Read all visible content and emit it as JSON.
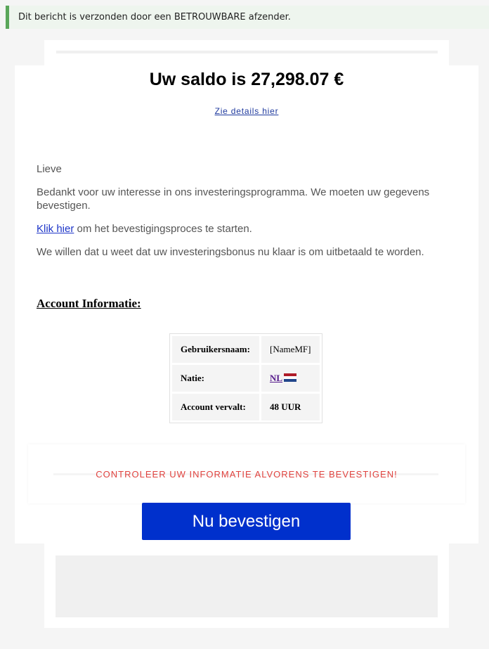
{
  "banner": {
    "text": "Dit bericht is verzonden door een BETROUWBARE afzender."
  },
  "header": {
    "title": "Uw saldo is 27,298.07 €",
    "details_link": "Zie details hier"
  },
  "body": {
    "greeting": "Lieve",
    "para1": "Bedankt voor uw interesse in ons investeringsprogramma. We moeten uw gegevens bevestigen.",
    "click_link": "Klik hier",
    "para2_rest": " om het bevestigingsproces te starten.",
    "para3": "We willen dat u weet dat uw investeringsbonus nu klaar is om uitbetaald te worden."
  },
  "account": {
    "heading": "Account Informatie:",
    "rows": [
      {
        "label": "Gebruikersnaam:",
        "value": "[NameMF]"
      },
      {
        "label": "Natie:",
        "value": "NL"
      },
      {
        "label": "Account vervalt:",
        "value": "48 UUR"
      }
    ],
    "flag_icon": "netherlands-flag-icon"
  },
  "warning": {
    "text": "CONTROLEER UW INFORMATIE ALVORENS TE BEVESTIGEN!"
  },
  "cta": {
    "label": "Nu bevestigen"
  },
  "colors": {
    "banner_bar": "#5aa65a",
    "warning": "#e0433f",
    "button": "#0030cc"
  }
}
